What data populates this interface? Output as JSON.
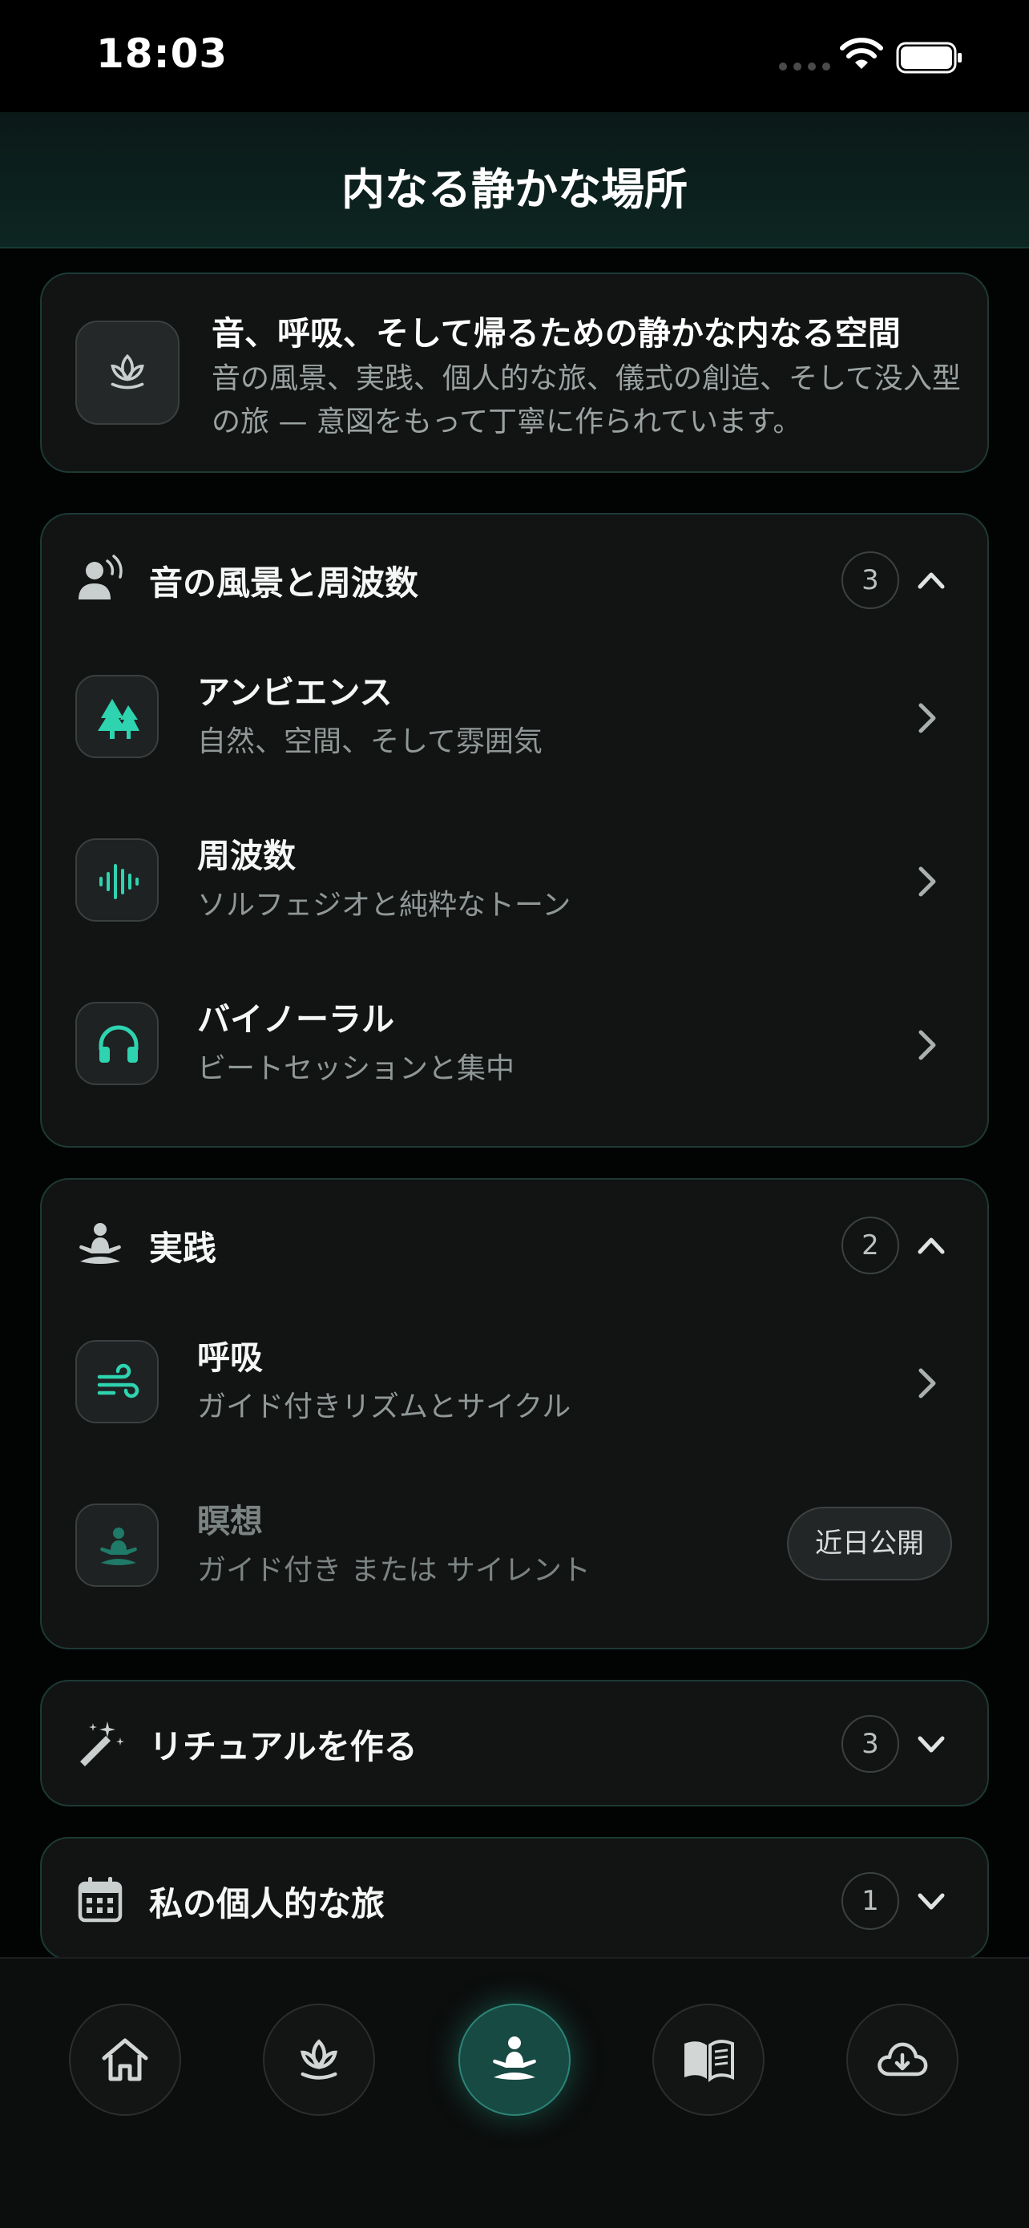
{
  "status_bar": {
    "time": "18:03"
  },
  "header": {
    "title": "内なる静かな場所"
  },
  "intro": {
    "title": "音、呼吸、そして帰るための静かな内なる空間",
    "description": "音の風景、実践、個人的な旅、儀式の創造、そして没入型の旅 — 意図をもって丁寧に作られています。",
    "icon": "lotus-icon"
  },
  "sections": [
    {
      "title": "音の風景と周波数",
      "count": "3",
      "expanded": true,
      "icon": "person-sound-icon",
      "items": [
        {
          "title": "アンビエンス",
          "subtitle": "自然、空間、そして雰囲気",
          "icon": "trees-icon"
        },
        {
          "title": "周波数",
          "subtitle": "ソルフェジオと純粋なトーン",
          "icon": "waveform-icon"
        },
        {
          "title": "バイノーラル",
          "subtitle": "ビートセッションと集中",
          "icon": "headphones-icon"
        }
      ]
    },
    {
      "title": "実践",
      "count": "2",
      "expanded": true,
      "icon": "meditation-icon",
      "items": [
        {
          "title": "呼吸",
          "subtitle": "ガイド付きリズムとサイクル",
          "icon": "wind-icon"
        },
        {
          "title": "瞑想",
          "subtitle": "ガイド付き または サイレント",
          "icon": "meditation-icon",
          "badge": "近日公開"
        }
      ]
    },
    {
      "title": "リチュアルを作る",
      "count": "3",
      "expanded": false,
      "icon": "magic-wand-icon"
    },
    {
      "title": "私の個人的な旅",
      "count": "1",
      "expanded": false,
      "icon": "calendar-icon"
    }
  ],
  "bottom_nav": [
    {
      "name": "home",
      "icon": "home-icon"
    },
    {
      "name": "lotus",
      "icon": "lotus-icon"
    },
    {
      "name": "meditation",
      "icon": "meditation-icon",
      "active": true
    },
    {
      "name": "library",
      "icon": "book-icon"
    },
    {
      "name": "downloads",
      "icon": "cloud-download-icon"
    }
  ],
  "colors": {
    "accent": "#2ed3b0",
    "background": "#020303",
    "card": "#121313",
    "border": "#1d3a35"
  }
}
